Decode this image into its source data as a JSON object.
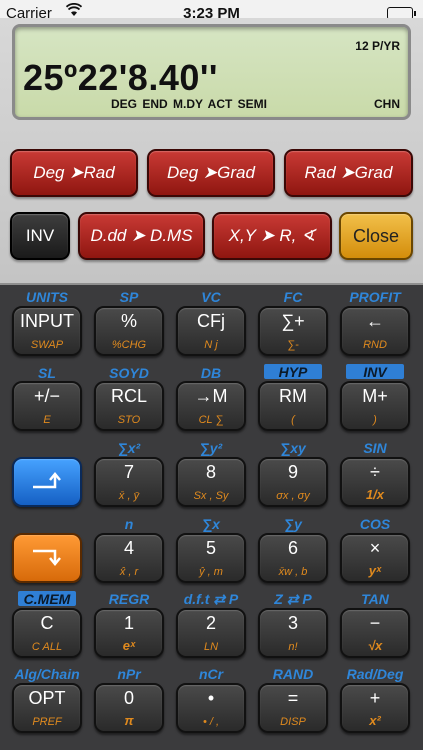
{
  "status": {
    "carrier": "Carrier",
    "time": "3:23 PM"
  },
  "lcd": {
    "ppy": "12 P/YR",
    "value": "25º22'8.40''",
    "annunciators": "DEG END M.DY ACT SEMI",
    "lang": "CHN"
  },
  "top_buttons": {
    "deg_rad": "Deg ➤Rad",
    "deg_grad": "Deg ➤Grad",
    "rad_grad": "Rad ➤Grad",
    "inv": "INV",
    "ddd_dms": "D.dd ➤ D.MS",
    "xy_r": "X,Y ➤ R, ∢",
    "close": "Close"
  },
  "labels": {
    "r1": [
      "UNITS",
      "SP",
      "VC",
      "FC",
      "PROFIT"
    ],
    "r2": [
      "SL",
      "SOYD",
      "DB",
      "HYP",
      "INV"
    ],
    "r3": [
      "∑x²",
      "∑y²",
      "∑xy",
      "SIN"
    ],
    "r4": [
      "n",
      "∑x",
      "∑y",
      "COS"
    ],
    "r5": [
      "C.MEM",
      "REGR",
      "d.f.t ⇄ P",
      "Z ⇄ P",
      "TAN"
    ],
    "r6": [
      "Alg/Chain",
      "nPr",
      "nCr",
      "RAND",
      "Rad/Deg"
    ]
  },
  "keys": {
    "r1": [
      {
        "main": "INPUT",
        "sub": "SWAP"
      },
      {
        "main": "%",
        "sub": "%CHG"
      },
      {
        "main": "CFj",
        "sub": "N j"
      },
      {
        "main": "∑+",
        "sub": "∑-"
      },
      {
        "main": "←",
        "sub": "RND"
      }
    ],
    "r2": [
      {
        "main": "+/−",
        "sub": "E"
      },
      {
        "main": "RCL",
        "sub": "STO"
      },
      {
        "main": "→M",
        "sub": "CL ∑"
      },
      {
        "main": "RM",
        "sub": "("
      },
      {
        "main": "M+",
        "sub": ")"
      }
    ],
    "r3": [
      {
        "main": "7",
        "sub": "x̄ , ȳ"
      },
      {
        "main": "8",
        "sub": "Sx , Sy"
      },
      {
        "main": "9",
        "sub": "σx , σy"
      },
      {
        "main": "÷",
        "sub": "1/x"
      }
    ],
    "r4": [
      {
        "main": "4",
        "sub": "x̂ , r"
      },
      {
        "main": "5",
        "sub": "ŷ , m"
      },
      {
        "main": "6",
        "sub": "x̄w , b"
      },
      {
        "main": "×",
        "sub": "yˣ"
      }
    ],
    "r5": [
      {
        "main": "C",
        "sub": "C ALL"
      },
      {
        "main": "1",
        "sub": "eˣ"
      },
      {
        "main": "2",
        "sub": "LN"
      },
      {
        "main": "3",
        "sub": "n!"
      },
      {
        "main": "−",
        "sub": "√x"
      }
    ],
    "r6": [
      {
        "main": "OPT",
        "sub": "PREF"
      },
      {
        "main": "0",
        "sub": "π"
      },
      {
        "main": "•",
        "sub": "• / ,"
      },
      {
        "main": "=",
        "sub": "DISP"
      },
      {
        "main": "+",
        "sub": "x²"
      }
    ]
  },
  "colors": {
    "label_blue": "#2f86d9",
    "sub_orange": "#e08a1e",
    "lcd_green": "#cfe0b6"
  }
}
